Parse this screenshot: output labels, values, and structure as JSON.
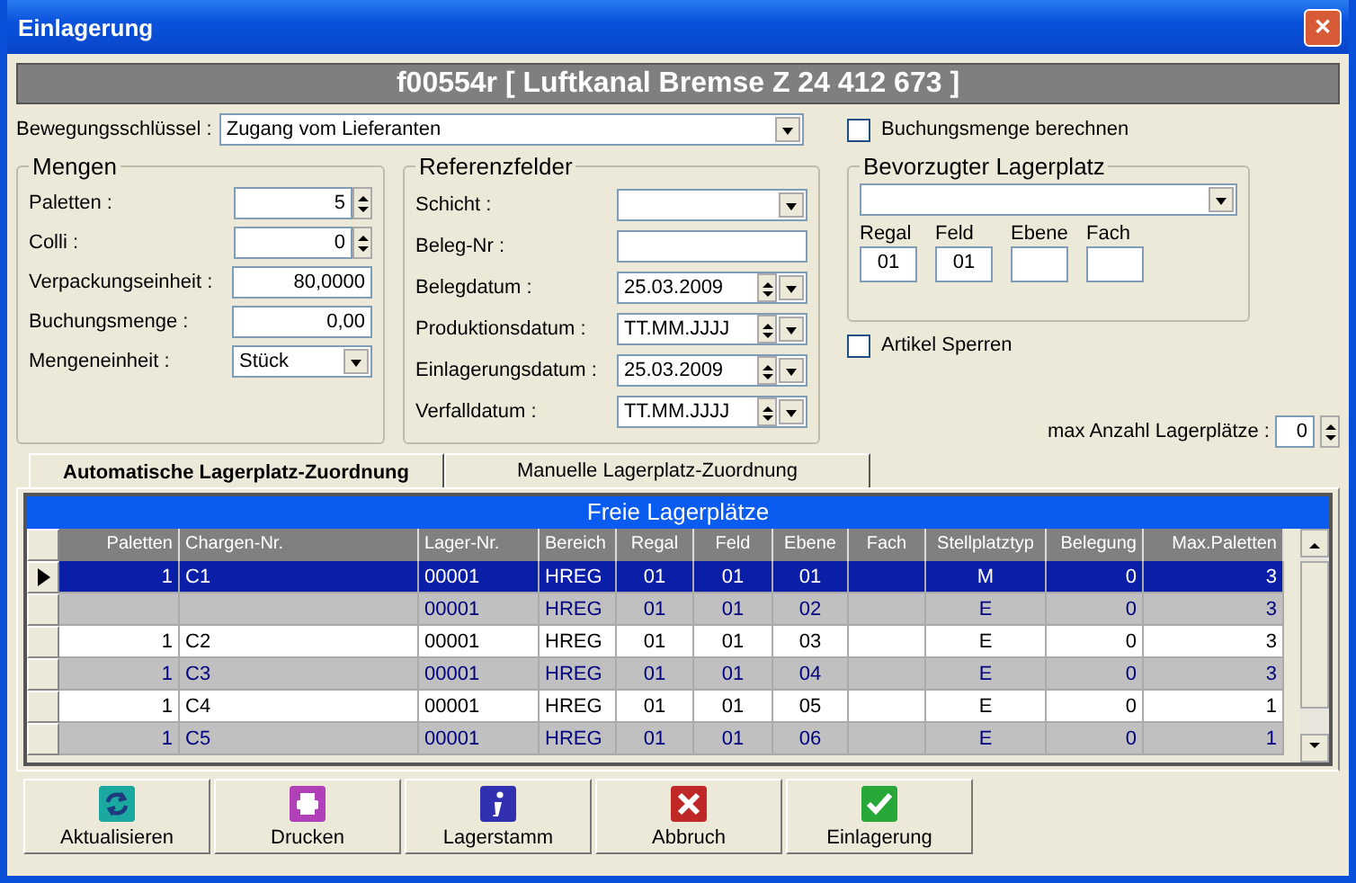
{
  "window": {
    "title": "Einlagerung",
    "close": "✕"
  },
  "header": "f00554r [ Luftkanal Bremse Z 24 412 673 ]",
  "bewegung": {
    "label": "Bewegungsschlüssel :",
    "value": "Zugang vom Lieferanten"
  },
  "buchungsmenge_berechnen": {
    "label": "Buchungsmenge berechnen",
    "checked": false
  },
  "mengen": {
    "title": "Mengen",
    "fields": [
      {
        "kind": "spin",
        "label": "Paletten :",
        "value": "5"
      },
      {
        "kind": "spin",
        "label": "Colli :",
        "value": "0"
      },
      {
        "kind": "text",
        "label": "Verpackungseinheit :",
        "value": "80,0000"
      },
      {
        "kind": "text",
        "label": "Buchungsmenge :",
        "value": "0,00"
      },
      {
        "kind": "combo",
        "label": "Mengeneinheit :",
        "value": "Stück"
      }
    ]
  },
  "referenz": {
    "title": "Referenzfelder",
    "fields": [
      {
        "kind": "combo",
        "label": "Schicht :"
      },
      {
        "kind": "text",
        "label": "Beleg-Nr :"
      },
      {
        "kind": "date",
        "label": "Belegdatum :",
        "value": "25.03.2009"
      },
      {
        "kind": "date",
        "label": "Produktionsdatum :",
        "value": "TT.MM.JJJJ"
      },
      {
        "kind": "date",
        "label": "Einlagerungsdatum :",
        "value": "25.03.2009"
      },
      {
        "kind": "date",
        "label": "Verfalldatum :",
        "value": "TT.MM.JJJJ"
      }
    ]
  },
  "lagerplatz": {
    "title": "Bevorzugter Lagerplatz",
    "fields": [
      {
        "label": "Regal",
        "value": "01"
      },
      {
        "label": "Feld",
        "value": "01"
      },
      {
        "label": "Ebene"
      },
      {
        "label": "Fach"
      }
    ]
  },
  "artikel_sperren": {
    "label": "Artikel Sperren",
    "checked": false
  },
  "max_anzahl": {
    "label": "max Anzahl Lagerplätze :",
    "value": "0"
  },
  "tabs": [
    {
      "label": "Automatische Lagerplatz-Zuordnung",
      "selected": true
    },
    {
      "label": "Manuelle Lagerplatz-Zuordnung",
      "selected": false
    }
  ],
  "table": {
    "title": "Freie Lagerplätze",
    "columns": [
      "Paletten",
      "Chargen-Nr.",
      "Lager-Nr.",
      "Bereich",
      "Regal",
      "Feld",
      "Ebene",
      "Fach",
      "Stellplatztyp",
      "Belegung",
      "Max.Paletten"
    ],
    "rows": [
      {
        "selected": true,
        "cells": [
          "1",
          "C1",
          "00001",
          "HREG",
          "01",
          "01",
          "01",
          "",
          "M",
          "0",
          "3"
        ]
      },
      {
        "selected": false,
        "cells": [
          "",
          "",
          "00001",
          "HREG",
          "01",
          "01",
          "02",
          "",
          "E",
          "0",
          "3"
        ]
      },
      {
        "selected": false,
        "cells": [
          "1",
          "C2",
          "00001",
          "HREG",
          "01",
          "01",
          "03",
          "",
          "E",
          "0",
          "3"
        ]
      },
      {
        "selected": false,
        "cells": [
          "1",
          "C3",
          "00001",
          "HREG",
          "01",
          "01",
          "04",
          "",
          "E",
          "0",
          "3"
        ]
      },
      {
        "selected": false,
        "cells": [
          "1",
          "C4",
          "00001",
          "HREG",
          "01",
          "01",
          "05",
          "",
          "E",
          "0",
          "1"
        ]
      },
      {
        "selected": false,
        "cells": [
          "1",
          "C5",
          "00001",
          "HREG",
          "01",
          "01",
          "06",
          "",
          "E",
          "0",
          "1"
        ]
      }
    ]
  },
  "buttons": [
    {
      "kind": "refresh",
      "label": "Aktualisieren"
    },
    {
      "kind": "print",
      "label": "Drucken"
    },
    {
      "kind": "info",
      "label": "Lagerstamm"
    },
    {
      "kind": "cancel",
      "label": "Abbruch"
    },
    {
      "kind": "ok",
      "label": "Einlagerung"
    }
  ]
}
